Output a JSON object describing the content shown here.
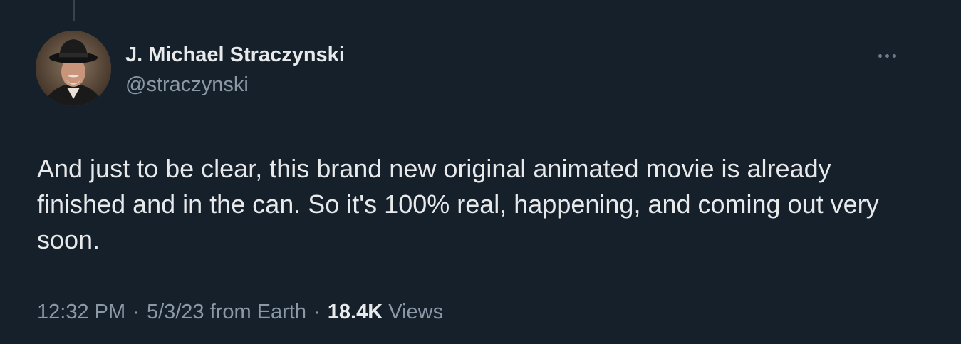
{
  "author": {
    "name": "J. Michael Straczynski",
    "handle": "@straczynski"
  },
  "tweet": {
    "text": "And just to be clear, this brand new original animated movie is already finished and in the can. So it's 100% real, happening, and coming out very soon."
  },
  "meta": {
    "time": "12:32 PM",
    "separator": "·",
    "date_location": "5/3/23 from Earth",
    "views_count": "18.4K",
    "views_label": "Views"
  },
  "icons": {
    "more": "more-horizontal-icon"
  },
  "colors": {
    "background": "#15202b",
    "primary_text": "#e7e9ea",
    "secondary_text": "#8b98a5",
    "thread_line": "#38444d"
  }
}
